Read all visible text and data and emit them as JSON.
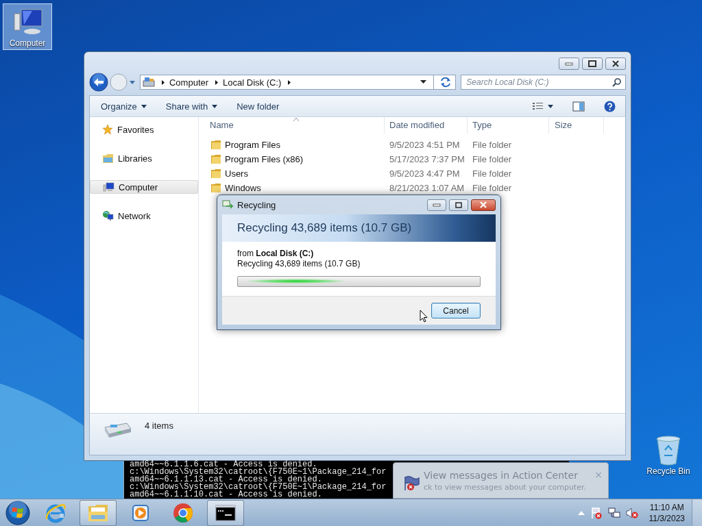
{
  "desktop_icons": [
    {
      "kind": "computer",
      "label": "Computer",
      "selected": true
    },
    {
      "kind": "recycle",
      "label": "Recycle Bin",
      "selected": false
    }
  ],
  "explorer": {
    "breadcrumb": [
      "Computer",
      "Local Disk (C:)"
    ],
    "search": {
      "placeholder": "Search Local Disk (C:)"
    },
    "toolbar": [
      {
        "label": "Organize",
        "menu": true
      },
      {
        "label": "Share with",
        "menu": true
      },
      {
        "label": "New folder",
        "menu": false
      }
    ],
    "sidebar": [
      {
        "kind": "star",
        "label": "Favorites",
        "selected": false
      },
      {
        "kind": "libraries",
        "label": "Libraries",
        "selected": false
      },
      {
        "kind": "computer",
        "label": "Computer",
        "selected": true
      },
      {
        "kind": "network",
        "label": "Network",
        "selected": false
      }
    ],
    "columns": [
      "Name",
      "Date modified",
      "Type",
      "Size"
    ],
    "rows": [
      {
        "name": "Program Files",
        "date": "9/5/2023 4:51 PM",
        "type": "File folder"
      },
      {
        "name": "Program Files (x86)",
        "date": "5/17/2023 7:37 PM",
        "type": "File folder"
      },
      {
        "name": "Users",
        "date": "9/5/2023 4:47 PM",
        "type": "File folder"
      },
      {
        "name": "Windows",
        "date": "8/21/2023 1:07 AM",
        "type": "File folder"
      }
    ],
    "status": "4 items"
  },
  "dialog": {
    "title": "Recycling",
    "heading": "Recycling 43,689 items (10.7 GB)",
    "source": "from **Local Disk (C:)**",
    "detail": "Recycling 43,689 items (10.7 GB)",
    "button": "Cancel",
    "marquee": true
  },
  "console": {
    "lines": [
      "amd64~~6.1.1.6.cat - Access is denied.",
      "c:\\Windows\\System32\\catroot\\{F750E~1\\Package_214_for",
      "amd64~~6.1.1.13.cat - Access is denied.",
      "c:\\Windows\\System32\\catroot\\{F750E~1\\Package_214_for",
      "amd64~~6.1.1.10.cat - Access is denied."
    ]
  },
  "notification": {
    "title": "View messages in Action Center",
    "text": "ck to view messages about your computer.",
    "close": "×"
  },
  "taskbar": {
    "apps": [
      {
        "kind": "ie",
        "running": false
      },
      {
        "kind": "explorer",
        "running": true
      },
      {
        "kind": "media",
        "running": false
      },
      {
        "kind": "chrome",
        "running": false
      },
      {
        "kind": "cmd",
        "running": true
      }
    ],
    "clock": {
      "time": "11:10 AM",
      "date": "11/3/2023"
    }
  }
}
